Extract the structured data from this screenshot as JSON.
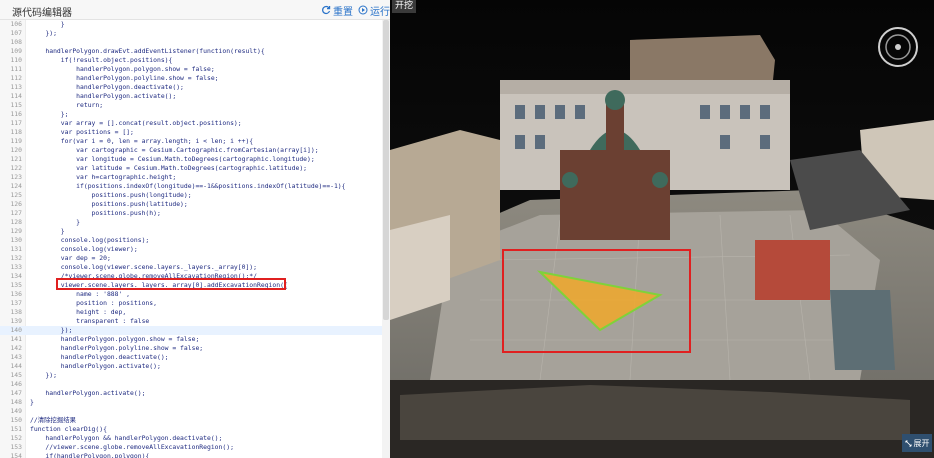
{
  "editor": {
    "title": "源代码编辑器",
    "reset_label": "重置",
    "run_label": "运行",
    "lines": [
      {
        "n": "106",
        "t": "        }"
      },
      {
        "n": "107",
        "t": "    });"
      },
      {
        "n": "108",
        "t": ""
      },
      {
        "n": "109",
        "t": "    handlerPolygon.drawEvt.addEventListener(function(result){"
      },
      {
        "n": "110",
        "t": "        if(!result.object.positions){"
      },
      {
        "n": "111",
        "t": "            handlerPolygon.polygon.show = false;"
      },
      {
        "n": "112",
        "t": "            handlerPolygon.polyline.show = false;"
      },
      {
        "n": "113",
        "t": "            handlerPolygon.deactivate();"
      },
      {
        "n": "114",
        "t": "            handlerPolygon.activate();"
      },
      {
        "n": "115",
        "t": "            return;"
      },
      {
        "n": "116",
        "t": "        };"
      },
      {
        "n": "117",
        "t": "        var array = [].concat(result.object.positions);"
      },
      {
        "n": "118",
        "t": "        var positions = [];"
      },
      {
        "n": "119",
        "t": "        for(var i = 0, len = array.length; i < len; i ++){"
      },
      {
        "n": "120",
        "t": "            var cartographic = Cesium.Cartographic.fromCartesian(array[i]);"
      },
      {
        "n": "121",
        "t": "            var longitude = Cesium.Math.toDegrees(cartographic.longitude);"
      },
      {
        "n": "122",
        "t": "            var latitude = Cesium.Math.toDegrees(cartographic.latitude);"
      },
      {
        "n": "123",
        "t": "            var h=cartographic.height;"
      },
      {
        "n": "124",
        "t": "            if(positions.indexOf(longitude)==-1&&positions.indexOf(latitude)==-1){"
      },
      {
        "n": "125",
        "t": "                positions.push(longitude);"
      },
      {
        "n": "126",
        "t": "                positions.push(latitude);"
      },
      {
        "n": "127",
        "t": "                positions.push(h);"
      },
      {
        "n": "128",
        "t": "            }"
      },
      {
        "n": "129",
        "t": "        }"
      },
      {
        "n": "130",
        "t": "        console.log(positions);"
      },
      {
        "n": "131",
        "t": "        console.log(viewer);"
      },
      {
        "n": "132",
        "t": "        var dep = 20;"
      },
      {
        "n": "133",
        "t": "        console.log(viewer.scene.layers._layers._array[0]);"
      },
      {
        "n": "134",
        "t": "        /*viewer.scene.globe.removeAllExcavationRegion();*/"
      },
      {
        "n": "135",
        "t": "        viewer.scene.layers._layers._array[0].addExcavationRegion({"
      },
      {
        "n": "136",
        "t": "            name : '888' ,"
      },
      {
        "n": "137",
        "t": "            position : positions,"
      },
      {
        "n": "138",
        "t": "            height : dep,"
      },
      {
        "n": "139",
        "t": "            transparent : false"
      },
      {
        "n": "140",
        "t": "        });"
      },
      {
        "n": "141",
        "t": "        handlerPolygon.polygon.show = false;"
      },
      {
        "n": "142",
        "t": "        handlerPolygon.polyline.show = false;"
      },
      {
        "n": "143",
        "t": "        handlerPolygon.deactivate();"
      },
      {
        "n": "144",
        "t": "        handlerPolygon.activate();"
      },
      {
        "n": "145",
        "t": "    });"
      },
      {
        "n": "146",
        "t": ""
      },
      {
        "n": "147",
        "t": "    handlerPolygon.activate();"
      },
      {
        "n": "148",
        "t": "}"
      },
      {
        "n": "149",
        "t": ""
      },
      {
        "n": "150",
        "t": "//清除挖掘结果"
      },
      {
        "n": "151",
        "t": "function clearDig(){"
      },
      {
        "n": "152",
        "t": "    handlerPolygon && handlerPolygon.deactivate();"
      },
      {
        "n": "153",
        "t": "    //viewer.scene.globe.removeAllExcavationRegion();"
      },
      {
        "n": "154",
        "t": "    if(handlerPolygon.polygon){"
      }
    ]
  },
  "viewer": {
    "tab_label": "开挖",
    "expand_label": "展开"
  },
  "colors": {
    "link": "#2a73c9",
    "highlight_box": "#e02020",
    "dig_polygon": "#f0a82a",
    "dig_outline": "#7fd23a"
  }
}
